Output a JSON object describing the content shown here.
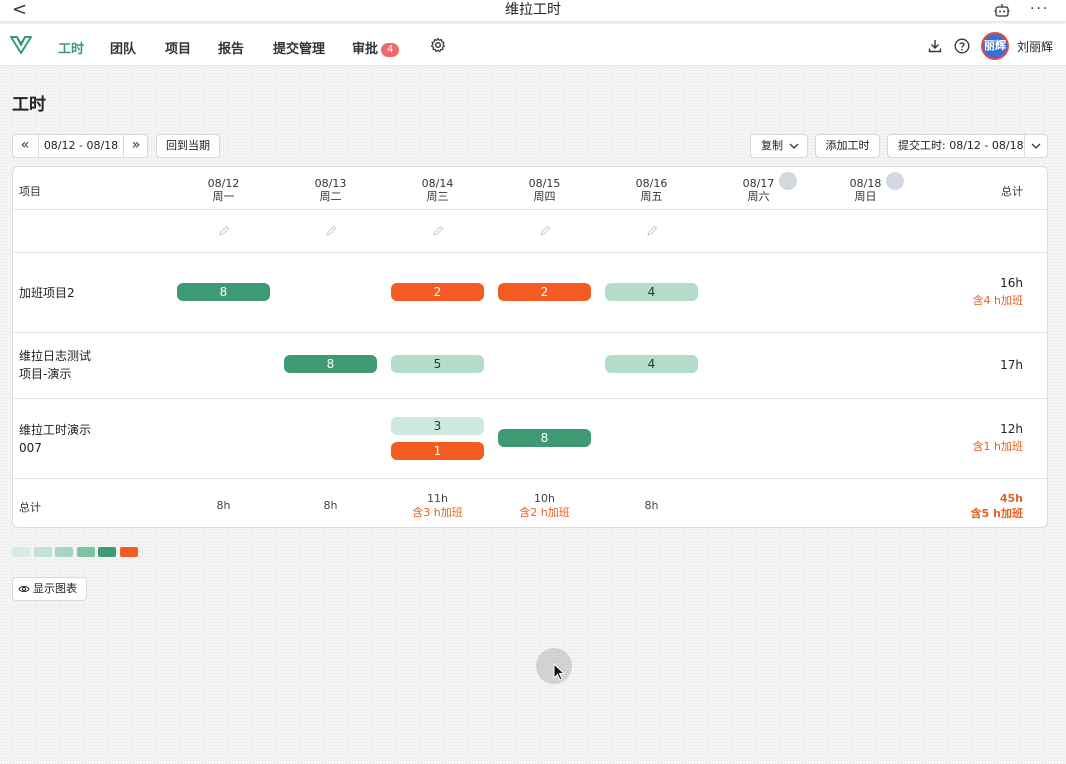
{
  "window": {
    "title": "维拉工时",
    "back_glyph": "<",
    "more_glyph": "···"
  },
  "nav": {
    "items": [
      {
        "label": "工时",
        "active": true
      },
      {
        "label": "团队"
      },
      {
        "label": "项目"
      },
      {
        "label": "报告"
      },
      {
        "label": "提交管理"
      },
      {
        "label": "审批",
        "badge": "4"
      }
    ],
    "user": "刘丽辉",
    "avatar_text": "丽辉"
  },
  "page": {
    "title": "工时"
  },
  "toolbar": {
    "prev_glyph": "«",
    "next_glyph": "»",
    "week_range": "08/12 - 08/18",
    "back_to_current": "回到当期",
    "copy": "复制",
    "add_time": "添加工时",
    "submit": "提交工时: 08/12 - 08/18"
  },
  "table": {
    "header_project": "项目",
    "header_total": "总计",
    "days": [
      {
        "date": "08/12",
        "weekday": "周一"
      },
      {
        "date": "08/13",
        "weekday": "周二"
      },
      {
        "date": "08/14",
        "weekday": "周三"
      },
      {
        "date": "08/15",
        "weekday": "周四"
      },
      {
        "date": "08/16",
        "weekday": "周五"
      },
      {
        "date": "08/17",
        "weekday": "周六"
      },
      {
        "date": "08/18",
        "weekday": "周日"
      }
    ],
    "rows": [
      {
        "project": "加班项目2",
        "cells": [
          "8",
          "2",
          "2",
          "4"
        ],
        "total": "16h",
        "overtime": "含4 h加班"
      },
      {
        "project": "维拉日志测试项目-演示",
        "cells": [
          "8",
          "5",
          "4"
        ],
        "total": "17h",
        "overtime": ""
      },
      {
        "project": "维拉工时演示007",
        "cells": [
          "3",
          "1",
          "8"
        ],
        "total": "12h",
        "overtime": "含1 h加班"
      }
    ],
    "footer_label": "总计",
    "footer": [
      {
        "value": "8h",
        "overtime": ""
      },
      {
        "value": "8h",
        "overtime": ""
      },
      {
        "value": "11h",
        "overtime": "含3 h加班"
      },
      {
        "value": "10h",
        "overtime": "含2 h加班"
      },
      {
        "value": "8h",
        "overtime": ""
      }
    ],
    "footer_total": "45h",
    "footer_total_overtime": "含5 h加班"
  },
  "legend_colors": [
    "#d6ebe2",
    "#c2e2d5",
    "#a8d5c2",
    "#7ec3a5",
    "#3d9a73",
    "#f45b20"
  ],
  "show_chart": "显示图表",
  "colors": {
    "accent": "#3a9b73",
    "overtime": "#f45b20",
    "badge": "#f06a6a"
  }
}
